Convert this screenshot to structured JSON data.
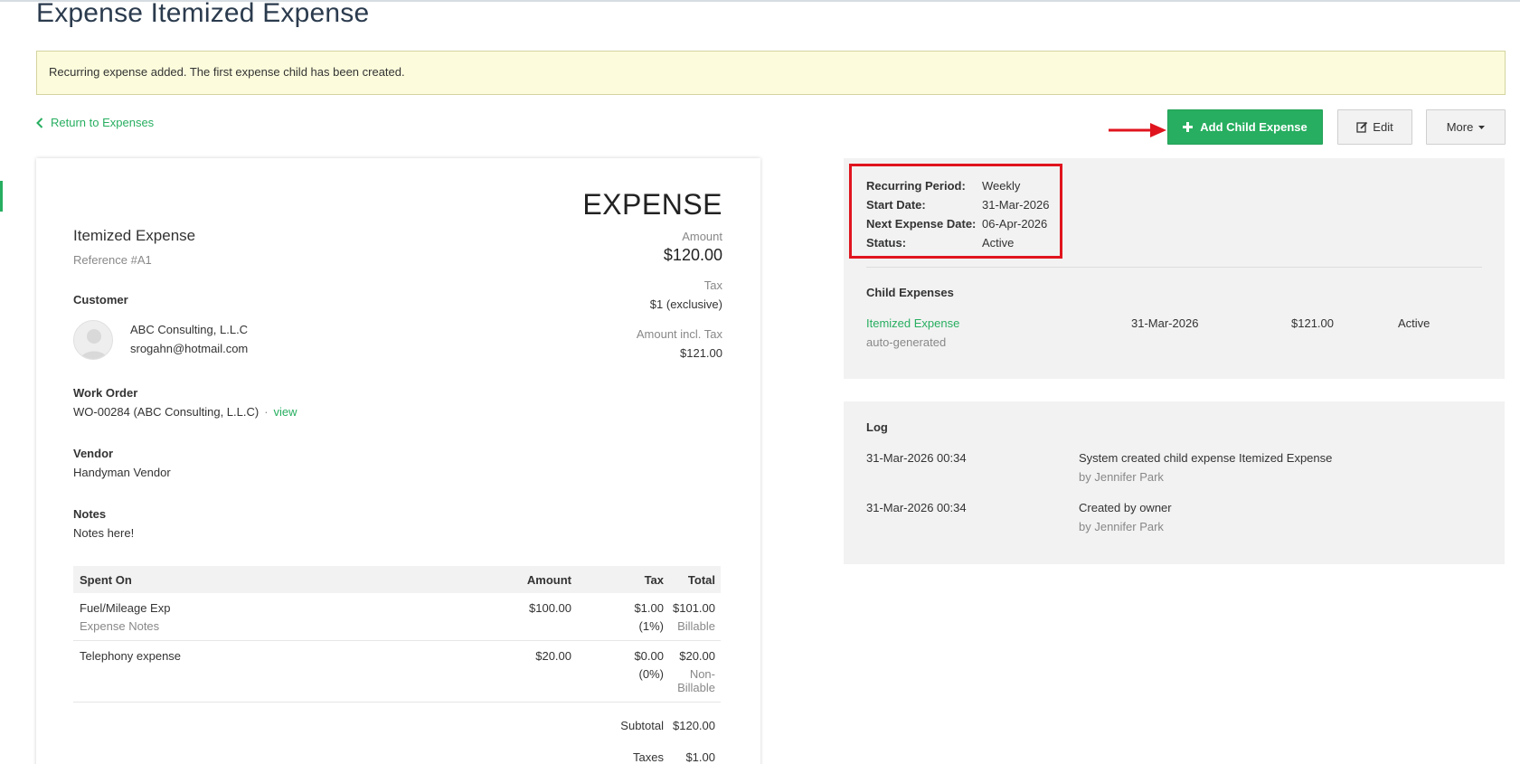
{
  "page": {
    "title": "Expense Itemized Expense",
    "alert": "Recurring expense added. The first expense child has been created.",
    "back_link": "Return to Expenses"
  },
  "actions": {
    "add_child": "Add Child Expense",
    "edit": "Edit",
    "more": "More"
  },
  "expense": {
    "doc_type": "EXPENSE",
    "name": "Itemized Expense",
    "reference": "Reference #A1",
    "amount_label": "Amount",
    "amount": "$120.00",
    "tax_label": "Tax",
    "tax": "$1 (exclusive)",
    "incl_label": "Amount incl. Tax",
    "incl": "$121.00",
    "customer_label": "Customer",
    "customer_name": "ABC Consulting, L.L.C",
    "customer_email": "srogahn@hotmail.com",
    "work_order_label": "Work Order",
    "work_order": "WO-00284 (ABC Consulting, L.L.C)",
    "work_order_sep": "·",
    "work_order_link": "view",
    "vendor_label": "Vendor",
    "vendor": "Handyman Vendor",
    "notes_label": "Notes",
    "notes": "Notes here!",
    "table": {
      "headers": [
        "Spent On",
        "Amount",
        "Tax",
        "Total"
      ],
      "rows": [
        {
          "name": "Fuel/Mileage Exp",
          "note": "Expense Notes",
          "amount": "$100.00",
          "tax": "$1.00",
          "tax_rate": "(1%)",
          "total": "$101.00",
          "billing": "Billable"
        },
        {
          "name": "Telephony expense",
          "note": "",
          "amount": "$20.00",
          "tax": "$0.00",
          "tax_rate": "(0%)",
          "total": "$20.00",
          "billing": "Non-Billable"
        }
      ],
      "subtotal_label": "Subtotal",
      "subtotal": "$120.00",
      "taxes_label": "Taxes",
      "taxes": "$1.00"
    }
  },
  "recurring": {
    "period_label": "Recurring Period:",
    "period": "Weekly",
    "start_label": "Start Date:",
    "start": "31-Mar-2026",
    "next_label": "Next Expense Date:",
    "next": "06-Apr-2026",
    "status_label": "Status:",
    "status": "Active"
  },
  "child_expenses": {
    "title": "Child Expenses",
    "items": [
      {
        "name": "Itemized Expense",
        "sub": "auto-generated",
        "date": "31-Mar-2026",
        "amount": "$121.00",
        "status": "Active"
      }
    ]
  },
  "log": {
    "title": "Log",
    "entries": [
      {
        "time": "31-Mar-2026 00:34",
        "message": "System created child expense Itemized Expense",
        "by": "by Jennifer Park"
      },
      {
        "time": "31-Mar-2026 00:34",
        "message": "Created by owner",
        "by": "by Jennifer Park"
      }
    ]
  },
  "colors": {
    "accent": "#27ae60",
    "annotation": "#e0141e",
    "alert_bg": "#fcfcdc",
    "panel_bg": "#f2f2f2"
  },
  "icons": {
    "back": "chevron-left-icon",
    "add": "plus-icon",
    "edit": "edit-icon",
    "more": "caret-down-icon",
    "annotation_arrow": "arrow-right-icon",
    "avatar": "user-avatar-icon"
  }
}
